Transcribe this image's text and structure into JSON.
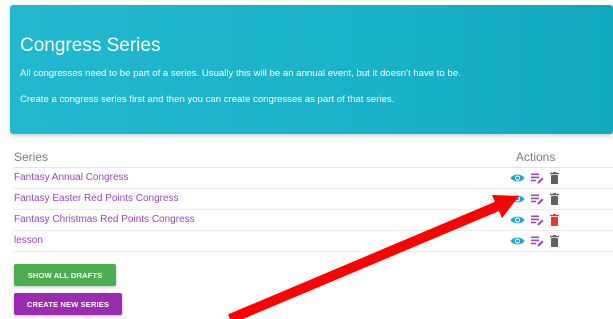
{
  "header": {
    "title": "Congress Series",
    "line1": "All congresses need to be part of a series. Usually this will be an annual event, but it doesn't have to be.",
    "line2": "Create a congress series first and then you can create congresses as part of that series."
  },
  "table": {
    "col_series": "Series",
    "col_actions": "Actions",
    "rows": [
      {
        "name": "Fantasy Annual Congress"
      },
      {
        "name": "Fantasy Easter Red Points Congress"
      },
      {
        "name": "Fantasy Christmas Red Points Congress"
      },
      {
        "name": "lesson"
      }
    ]
  },
  "buttons": {
    "show_drafts": "SHOW ALL DRAFTS",
    "create_series": "CREATE NEW SERIES"
  },
  "icons": {
    "view": "eye-icon",
    "edit": "edit-icon",
    "delete": "trash-icon"
  },
  "colors": {
    "header_bg": "#1ab2c9",
    "link": "#9c47b8",
    "view_icon": "#1aa8d6",
    "edit_icon": "#9c47b8",
    "trash_icon": "#616161",
    "trash_icon_active": "#e53935",
    "drafts_button": "#4cae50",
    "create_button": "#9b2bb0",
    "annotation_arrow": "#ff0000"
  }
}
